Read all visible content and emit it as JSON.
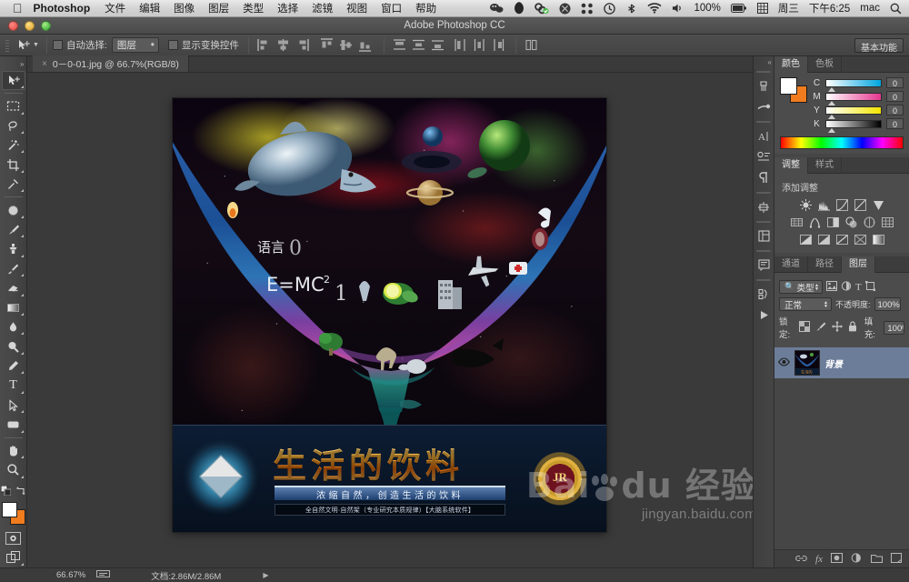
{
  "mac_menu": {
    "apple_icon": "apple-icon",
    "app_name": "Photoshop",
    "items": [
      "文件",
      "编辑",
      "图像",
      "图层",
      "类型",
      "选择",
      "滤镜",
      "视图",
      "窗口",
      "帮助"
    ],
    "status_icons": [
      "wechat-icon",
      "qq-penguin-icon",
      "cloud-sync-icon",
      "x-circle-icon",
      "dropbox-icon",
      "timemachine-icon",
      "bluetooth-icon",
      "wifi-icon",
      "volume-icon"
    ],
    "battery_percent": "100%",
    "battery_icon": "battery-icon",
    "input_icon": "input-source-icon",
    "day": "周三",
    "time": "下午6:25",
    "user": "mac",
    "search_icon": "spotlight-search-icon"
  },
  "title_bar": {
    "title": "Adobe Photoshop CC",
    "close": "close-button",
    "minimize": "minimize-button",
    "zoom": "zoom-button"
  },
  "options_bar": {
    "tool_icon": "move-tool-icon",
    "tool_dropdown_icon": "chevron-down-icon",
    "auto_select_label": "自动选择:",
    "auto_select_value": "图层",
    "show_transform_label": "显示变换控件",
    "align_icons": [
      "align-left-edges",
      "align-horizontal-centers",
      "align-right-edges",
      "align-top-edges",
      "align-vertical-centers",
      "align-bottom-edges"
    ],
    "distribute_icons": [
      "distribute-top-edges",
      "distribute-vertical-centers",
      "distribute-bottom-edges",
      "distribute-left-edges",
      "distribute-horizontal-centers",
      "distribute-right-edges"
    ],
    "auto_align_icon": "auto-align-layers",
    "workspace_button": "基本功能"
  },
  "document_tab": {
    "close_icon": "close-tab-icon",
    "label": "0－0-01.jpg @ 66.7%(RGB/8)"
  },
  "toolbar": {
    "collapse_icon": "double-chevron-icon",
    "tools": [
      {
        "name": "move-tool",
        "glyph": "move",
        "selected": true
      },
      {
        "name": "marquee-tool",
        "glyph": "marquee",
        "selected": false
      },
      {
        "name": "lasso-tool",
        "glyph": "lasso",
        "selected": false
      },
      {
        "name": "magic-wand-tool",
        "glyph": "wand",
        "selected": false
      },
      {
        "name": "crop-tool",
        "glyph": "crop",
        "selected": false
      },
      {
        "name": "eyedropper-tool",
        "glyph": "eyedropper",
        "selected": false
      },
      {
        "name": "spot-healing-tool",
        "glyph": "healing",
        "selected": false
      },
      {
        "name": "brush-tool",
        "glyph": "brush",
        "selected": false
      },
      {
        "name": "clone-stamp-tool",
        "glyph": "stamp",
        "selected": false
      },
      {
        "name": "history-brush-tool",
        "glyph": "history-brush",
        "selected": false
      },
      {
        "name": "eraser-tool",
        "glyph": "eraser",
        "selected": false
      },
      {
        "name": "gradient-tool",
        "glyph": "gradient",
        "selected": false
      },
      {
        "name": "blur-tool",
        "glyph": "blur",
        "selected": false
      },
      {
        "name": "dodge-tool",
        "glyph": "dodge",
        "selected": false
      },
      {
        "name": "pen-tool",
        "glyph": "pen",
        "selected": false
      },
      {
        "name": "type-tool",
        "glyph": "type",
        "selected": false
      },
      {
        "name": "path-selection-tool",
        "glyph": "arrow",
        "selected": false
      },
      {
        "name": "shape-tool",
        "glyph": "rect",
        "selected": false
      },
      {
        "name": "hand-tool",
        "glyph": "hand",
        "selected": false
      },
      {
        "name": "zoom-tool",
        "glyph": "magnifier",
        "selected": false
      }
    ],
    "swap_colors_icon": "swap-colors-icon",
    "default_colors_icon": "default-colors-icon",
    "foreground_color": "#ffffff",
    "background_color": "#f07c1e",
    "quick_mask_icon": "quick-mask-icon",
    "screen_mode_icon": "screen-mode-icon"
  },
  "right_rail": {
    "collapse_icon": "double-chevron-right-icon",
    "icons": [
      "history-brush-panel-icon",
      "tool-presets-icon",
      "character-panel-icon",
      "character-styles-icon",
      "paragraph-panel-icon",
      "3d-panel-icon",
      "properties-panel-icon",
      "notes-panel-icon",
      "clone-source-icon",
      "actions-play-icon"
    ]
  },
  "color_panel": {
    "tabs": [
      {
        "label": "颜色",
        "active": true
      },
      {
        "label": "色板",
        "active": false
      }
    ],
    "foreground": "#ffffff",
    "background": "#f07c1e",
    "channels": [
      {
        "label": "C",
        "value": "0"
      },
      {
        "label": "M",
        "value": "0"
      },
      {
        "label": "Y",
        "value": "0"
      },
      {
        "label": "K",
        "value": "0"
      }
    ]
  },
  "adjustments_panel": {
    "tabs": [
      {
        "label": "调整",
        "active": true
      },
      {
        "label": "样式",
        "active": false
      }
    ],
    "heading": "添加调整",
    "buttons": [
      "brightness-contrast-icon",
      "levels-icon",
      "curves-icon",
      "exposure-icon",
      "vibrance-icon",
      "hue-saturation-icon",
      "color-balance-icon",
      "black-white-icon",
      "photo-filter-icon",
      "channel-mixer-icon",
      "color-lookup-icon",
      "invert-icon",
      "posterize-icon",
      "threshold-icon",
      "selective-color-icon",
      "gradient-map-icon"
    ]
  },
  "layers_panel": {
    "tabs": [
      {
        "label": "通道",
        "active": false
      },
      {
        "label": "路径",
        "active": false
      },
      {
        "label": "图层",
        "active": true
      }
    ],
    "filter_icon": "search-filter-icon",
    "filter_value": "类型",
    "filter_kind_icons": [
      "pixel-layer-filter-icon",
      "adjustment-layer-filter-icon",
      "type-layer-filter-icon",
      "shape-layer-filter-icon",
      "smart-object-filter-icon"
    ],
    "blend_mode": "正常",
    "opacity_label": "不透明度:",
    "opacity_value": "100%",
    "lock_label": "锁定:",
    "lock_icons": [
      "lock-transparency-icon",
      "lock-image-icon",
      "lock-position-icon",
      "lock-all-icon"
    ],
    "fill_label": "填充:",
    "fill_value": "100%",
    "layers": [
      {
        "name": "背景",
        "visible": true,
        "selected": true,
        "eye_icon": "eye-icon",
        "thumbnail": "layer-thumbnail"
      }
    ],
    "bottom_buttons": [
      "link-layers-icon",
      "layer-style-fx-icon",
      "add-layer-mask-icon",
      "new-adjustment-layer-icon",
      "new-group-icon",
      "new-layer-icon"
    ]
  },
  "status_bar": {
    "zoom": "66.67%",
    "doc_icon": "document-dimensions-icon",
    "doc_size": "文档:2.86M/2.86M",
    "expand_icon": "expand-arrow-icon"
  },
  "artwork": {
    "title_text": "生活的饮料",
    "subtitle_text": "浓缩自然，创造生活的饮料",
    "tagline_text": "全自然文明·自然架（专业研究本质规律）【大脑系统软件】",
    "crest_text": "JR",
    "funnel_words": [
      "语言",
      "0",
      "E=MC²",
      "1"
    ],
    "icon_objects": [
      "dolphin",
      "earth-planet",
      "saturn-planet",
      "blue-planet",
      "galaxy-spiral",
      "airplane",
      "skyscraper",
      "apple-fruit",
      "music-note",
      "first-aid-kit",
      "broccoli",
      "dinosaur",
      "whale",
      "rhino",
      "tree",
      "violin"
    ]
  },
  "watermark": {
    "brand_a": "Bai",
    "brand_b": "du",
    "brand_cn": "经验",
    "url": "jingyan.baidu.com",
    "paw_icon": "baidu-paw-icon"
  },
  "colors": {
    "accent_blue": "#6c7d99",
    "panel_bg": "#4c4c4c",
    "chrome_bg": "#3b3b3b",
    "orange": "#f07c1e"
  }
}
